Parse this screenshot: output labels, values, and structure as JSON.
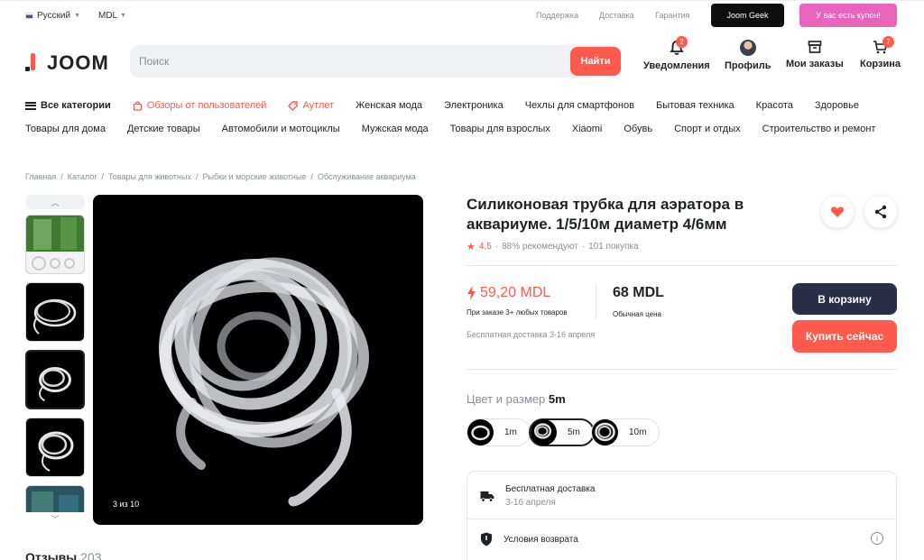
{
  "topbar": {
    "language": "Русский",
    "currency": "MDL",
    "links": [
      "Поддержка",
      "Доставка",
      "Гарантия"
    ],
    "geek_label": "Joom Geek",
    "coupon_label": "У вас есть купон!"
  },
  "header": {
    "logo": "JOOM",
    "search_placeholder": "Поиск",
    "search_button": "Найти",
    "notifications": {
      "label": "Уведомления",
      "count": "2"
    },
    "profile": "Профиль",
    "orders": "Мои заказы",
    "cart": {
      "label": "Корзина",
      "count": "7"
    }
  },
  "nav": {
    "row1": [
      {
        "label": "Все категории",
        "style": "bold"
      },
      {
        "label": "Обзоры от пользователей",
        "style": "red"
      },
      {
        "label": "Аутлет",
        "style": "red"
      },
      {
        "label": "Женская мода"
      },
      {
        "label": "Электроника"
      },
      {
        "label": "Чехлы для смартфонов"
      },
      {
        "label": "Бытовая техника"
      },
      {
        "label": "Красота"
      },
      {
        "label": "Здоровье"
      }
    ],
    "row2": [
      "Товары для дома",
      "Детские товары",
      "Автомобили и мотоциклы",
      "Мужская мода",
      "Товары для взрослых",
      "Xiaomi",
      "Обувь",
      "Спорт и отдых",
      "Строительство и ремонт"
    ]
  },
  "breadcrumb": [
    "Главная",
    "Каталог",
    "Товары для животных",
    "Рыбки и морские животные",
    "Обслуживание аквариума"
  ],
  "gallery": {
    "counter": "3 из 10"
  },
  "reviews": {
    "label": "Отзывы",
    "count": "203"
  },
  "product": {
    "title": "Силиконовая трубка для аэратора в аквариуме. 1/5/10м диаметр 4/6мм",
    "rating": "4,5",
    "recommend": "88% рекомендуют",
    "purchases": "101 покупка",
    "sale_price": "59,20 MDL",
    "sale_note": "При заказе 3+ любых товаров",
    "regular_price": "68 MDL",
    "regular_note": "Обычная цена",
    "shipping_note": "Бесплатная доставка 3-16 апреля",
    "cart_button": "В корзину",
    "buy_button": "Купить сейчас",
    "variant_label": "Цвет и размер",
    "variant_selected": "5m",
    "variants": [
      "1m",
      "5m",
      "10m"
    ]
  },
  "info": {
    "delivery_title": "Бесплатная доставка",
    "delivery_sub": "3-16 апреля",
    "returns_title": "Условия возврата"
  },
  "colors": {
    "accent": "#ff5a4d",
    "dark_button": "#2a2f45",
    "coupon": "#e964bb"
  }
}
